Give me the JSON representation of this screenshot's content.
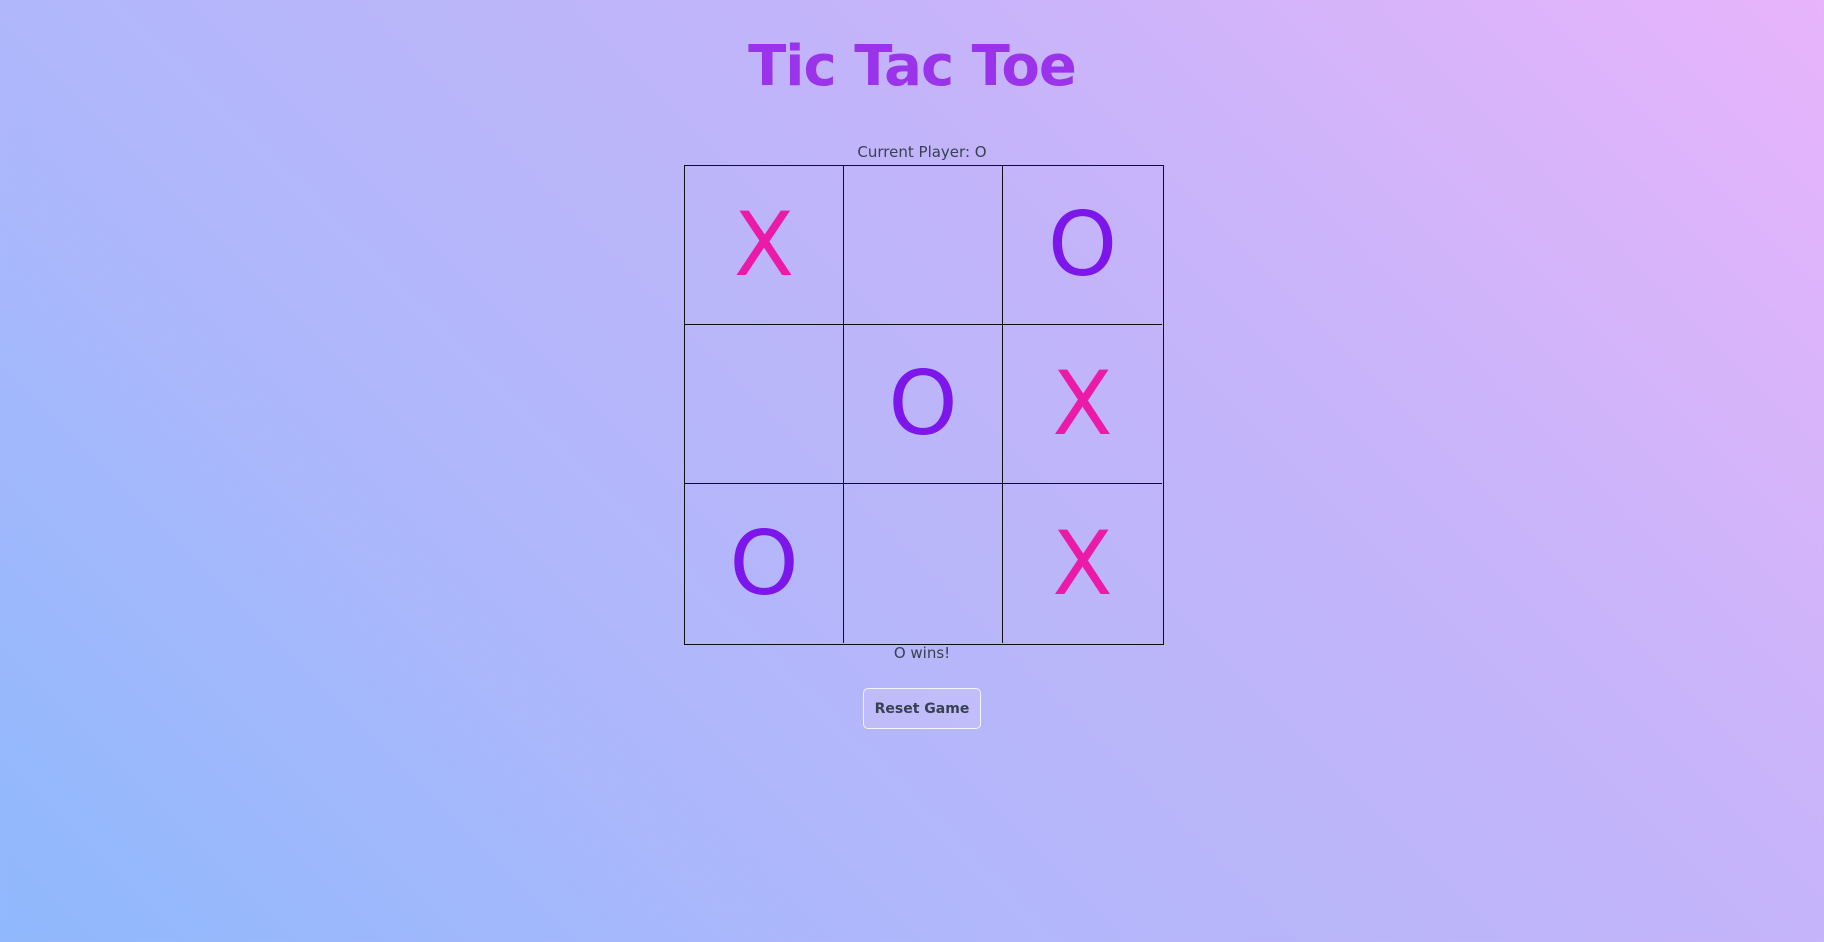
{
  "title": "Tic Tac Toe",
  "current_player_text": "Current Player: O",
  "board": {
    "cells": [
      "X",
      "",
      "O",
      "",
      "O",
      "X",
      "O",
      "",
      "X"
    ]
  },
  "status_text": "O wins!",
  "reset_label": "Reset Game",
  "colors": {
    "title": "#9a33ea",
    "x_mark": "#ec1aa8",
    "o_mark": "#7c16ea",
    "text": "#374151",
    "grid_line": "#111111"
  }
}
